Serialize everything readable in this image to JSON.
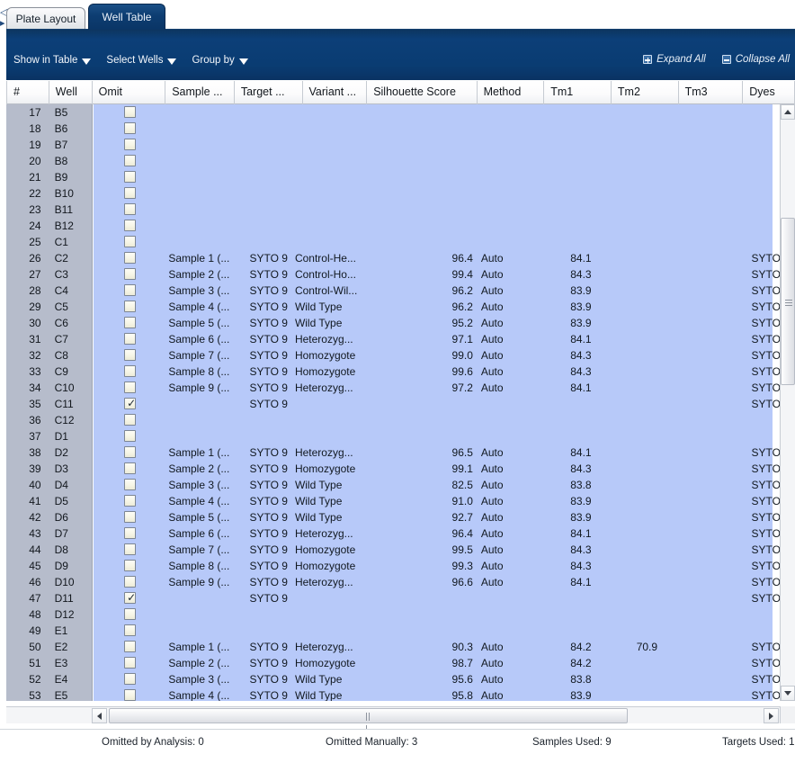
{
  "tabs": [
    {
      "label": "Plate Layout",
      "active": false
    },
    {
      "label": "Well Table",
      "active": true
    }
  ],
  "toolbar": {
    "show_in_table": "Show in Table",
    "select_wells": "Select Wells",
    "group_by": "Group by",
    "expand_all": "Expand All",
    "collapse_all": "Collapse All",
    "expand_icon": "plus-box-icon",
    "collapse_icon": "minus-box-icon",
    "caret_icon": "chevron-down-icon",
    "bg_color": "#0a3c72"
  },
  "table": {
    "columns": [
      {
        "key": "num",
        "label": "#"
      },
      {
        "key": "well",
        "label": "Well"
      },
      {
        "key": "omit",
        "label": "Omit"
      },
      {
        "key": "sample",
        "label": "Sample ..."
      },
      {
        "key": "target",
        "label": "Target ..."
      },
      {
        "key": "variant",
        "label": "Variant ..."
      },
      {
        "key": "silhouette",
        "label": "Silhouette Score"
      },
      {
        "key": "method",
        "label": "Method"
      },
      {
        "key": "tm1",
        "label": "Tm1"
      },
      {
        "key": "tm2",
        "label": "Tm2"
      },
      {
        "key": "tm3",
        "label": "Tm3"
      },
      {
        "key": "dyes",
        "label": "Dyes"
      }
    ],
    "selection_color": "#b7c9f9",
    "rowheader_color": "#b6bccb",
    "rows": [
      {
        "num": "17",
        "well": "B5",
        "omit": false,
        "sample": "",
        "dye": "",
        "variant": "",
        "sil": "",
        "method": "",
        "tm1": "",
        "tm2": "",
        "tm3": "",
        "dyes": ""
      },
      {
        "num": "18",
        "well": "B6",
        "omit": false,
        "sample": "",
        "dye": "",
        "variant": "",
        "sil": "",
        "method": "",
        "tm1": "",
        "tm2": "",
        "tm3": "",
        "dyes": ""
      },
      {
        "num": "19",
        "well": "B7",
        "omit": false,
        "sample": "",
        "dye": "",
        "variant": "",
        "sil": "",
        "method": "",
        "tm1": "",
        "tm2": "",
        "tm3": "",
        "dyes": ""
      },
      {
        "num": "20",
        "well": "B8",
        "omit": false,
        "sample": "",
        "dye": "",
        "variant": "",
        "sil": "",
        "method": "",
        "tm1": "",
        "tm2": "",
        "tm3": "",
        "dyes": ""
      },
      {
        "num": "21",
        "well": "B9",
        "omit": false,
        "sample": "",
        "dye": "",
        "variant": "",
        "sil": "",
        "method": "",
        "tm1": "",
        "tm2": "",
        "tm3": "",
        "dyes": ""
      },
      {
        "num": "22",
        "well": "B10",
        "omit": false,
        "sample": "",
        "dye": "",
        "variant": "",
        "sil": "",
        "method": "",
        "tm1": "",
        "tm2": "",
        "tm3": "",
        "dyes": ""
      },
      {
        "num": "23",
        "well": "B11",
        "omit": false,
        "sample": "",
        "dye": "",
        "variant": "",
        "sil": "",
        "method": "",
        "tm1": "",
        "tm2": "",
        "tm3": "",
        "dyes": ""
      },
      {
        "num": "24",
        "well": "B12",
        "omit": false,
        "sample": "",
        "dye": "",
        "variant": "",
        "sil": "",
        "method": "",
        "tm1": "",
        "tm2": "",
        "tm3": "",
        "dyes": ""
      },
      {
        "num": "25",
        "well": "C1",
        "omit": false,
        "sample": "",
        "dye": "",
        "variant": "",
        "sil": "",
        "method": "",
        "tm1": "",
        "tm2": "",
        "tm3": "",
        "dyes": ""
      },
      {
        "num": "26",
        "well": "C2",
        "omit": false,
        "sample": "Sample 1 (...",
        "dye": "SYTO 9",
        "variant": "Control-He...",
        "sil": "96.4",
        "method": "Auto",
        "tm1": "84.1",
        "tm2": "",
        "tm3": "",
        "dyes": "SYTO"
      },
      {
        "num": "27",
        "well": "C3",
        "omit": false,
        "sample": "Sample 2 (...",
        "dye": "SYTO 9",
        "variant": "Control-Ho...",
        "sil": "99.4",
        "method": "Auto",
        "tm1": "84.3",
        "tm2": "",
        "tm3": "",
        "dyes": "SYTO"
      },
      {
        "num": "28",
        "well": "C4",
        "omit": false,
        "sample": "Sample 3 (...",
        "dye": "SYTO 9",
        "variant": "Control-Wil...",
        "sil": "96.2",
        "method": "Auto",
        "tm1": "83.9",
        "tm2": "",
        "tm3": "",
        "dyes": "SYTO"
      },
      {
        "num": "29",
        "well": "C5",
        "omit": false,
        "sample": "Sample 4 (...",
        "dye": "SYTO 9",
        "variant": "Wild Type",
        "sil": "96.2",
        "method": "Auto",
        "tm1": "83.9",
        "tm2": "",
        "tm3": "",
        "dyes": "SYTO"
      },
      {
        "num": "30",
        "well": "C6",
        "omit": false,
        "sample": "Sample 5 (...",
        "dye": "SYTO 9",
        "variant": "Wild Type",
        "sil": "95.2",
        "method": "Auto",
        "tm1": "83.9",
        "tm2": "",
        "tm3": "",
        "dyes": "SYTO"
      },
      {
        "num": "31",
        "well": "C7",
        "omit": false,
        "sample": "Sample 6 (...",
        "dye": "SYTO 9",
        "variant": "Heterozyg...",
        "sil": "97.1",
        "method": "Auto",
        "tm1": "84.1",
        "tm2": "",
        "tm3": "",
        "dyes": "SYTO"
      },
      {
        "num": "32",
        "well": "C8",
        "omit": false,
        "sample": "Sample 7 (...",
        "dye": "SYTO 9",
        "variant": "Homozygote",
        "sil": "99.0",
        "method": "Auto",
        "tm1": "84.3",
        "tm2": "",
        "tm3": "",
        "dyes": "SYTO"
      },
      {
        "num": "33",
        "well": "C9",
        "omit": false,
        "sample": "Sample 8 (...",
        "dye": "SYTO 9",
        "variant": "Homozygote",
        "sil": "99.6",
        "method": "Auto",
        "tm1": "84.3",
        "tm2": "",
        "tm3": "",
        "dyes": "SYTO"
      },
      {
        "num": "34",
        "well": "C10",
        "omit": false,
        "sample": "Sample 9 (...",
        "dye": "SYTO 9",
        "variant": "Heterozyg...",
        "sil": "97.2",
        "method": "Auto",
        "tm1": "84.1",
        "tm2": "",
        "tm3": "",
        "dyes": "SYTO"
      },
      {
        "num": "35",
        "well": "C11",
        "omit": true,
        "sample": "",
        "dye": "SYTO 9",
        "variant": "",
        "sil": "",
        "method": "",
        "tm1": "",
        "tm2": "",
        "tm3": "",
        "dyes": "SYTO"
      },
      {
        "num": "36",
        "well": "C12",
        "omit": false,
        "sample": "",
        "dye": "",
        "variant": "",
        "sil": "",
        "method": "",
        "tm1": "",
        "tm2": "",
        "tm3": "",
        "dyes": ""
      },
      {
        "num": "37",
        "well": "D1",
        "omit": false,
        "sample": "",
        "dye": "",
        "variant": "",
        "sil": "",
        "method": "",
        "tm1": "",
        "tm2": "",
        "tm3": "",
        "dyes": ""
      },
      {
        "num": "38",
        "well": "D2",
        "omit": false,
        "sample": "Sample 1 (...",
        "dye": "SYTO 9",
        "variant": "Heterozyg...",
        "sil": "96.5",
        "method": "Auto",
        "tm1": "84.1",
        "tm2": "",
        "tm3": "",
        "dyes": "SYTO"
      },
      {
        "num": "39",
        "well": "D3",
        "omit": false,
        "sample": "Sample 2 (...",
        "dye": "SYTO 9",
        "variant": "Homozygote",
        "sil": "99.1",
        "method": "Auto",
        "tm1": "84.3",
        "tm2": "",
        "tm3": "",
        "dyes": "SYTO"
      },
      {
        "num": "40",
        "well": "D4",
        "omit": false,
        "sample": "Sample 3 (...",
        "dye": "SYTO 9",
        "variant": "Wild Type",
        "sil": "82.5",
        "method": "Auto",
        "tm1": "83.8",
        "tm2": "",
        "tm3": "",
        "dyes": "SYTO"
      },
      {
        "num": "41",
        "well": "D5",
        "omit": false,
        "sample": "Sample 4 (...",
        "dye": "SYTO 9",
        "variant": "Wild Type",
        "sil": "91.0",
        "method": "Auto",
        "tm1": "83.9",
        "tm2": "",
        "tm3": "",
        "dyes": "SYTO"
      },
      {
        "num": "42",
        "well": "D6",
        "omit": false,
        "sample": "Sample 5 (...",
        "dye": "SYTO 9",
        "variant": "Wild Type",
        "sil": "92.7",
        "method": "Auto",
        "tm1": "83.9",
        "tm2": "",
        "tm3": "",
        "dyes": "SYTO"
      },
      {
        "num": "43",
        "well": "D7",
        "omit": false,
        "sample": "Sample 6 (...",
        "dye": "SYTO 9",
        "variant": "Heterozyg...",
        "sil": "96.4",
        "method": "Auto",
        "tm1": "84.1",
        "tm2": "",
        "tm3": "",
        "dyes": "SYTO"
      },
      {
        "num": "44",
        "well": "D8",
        "omit": false,
        "sample": "Sample 7 (...",
        "dye": "SYTO 9",
        "variant": "Homozygote",
        "sil": "99.5",
        "method": "Auto",
        "tm1": "84.3",
        "tm2": "",
        "tm3": "",
        "dyes": "SYTO"
      },
      {
        "num": "45",
        "well": "D9",
        "omit": false,
        "sample": "Sample 8 (...",
        "dye": "SYTO 9",
        "variant": "Homozygote",
        "sil": "99.3",
        "method": "Auto",
        "tm1": "84.3",
        "tm2": "",
        "tm3": "",
        "dyes": "SYTO"
      },
      {
        "num": "46",
        "well": "D10",
        "omit": false,
        "sample": "Sample 9 (...",
        "dye": "SYTO 9",
        "variant": "Heterozyg...",
        "sil": "96.6",
        "method": "Auto",
        "tm1": "84.1",
        "tm2": "",
        "tm3": "",
        "dyes": "SYTO"
      },
      {
        "num": "47",
        "well": "D11",
        "omit": true,
        "sample": "",
        "dye": "SYTO 9",
        "variant": "",
        "sil": "",
        "method": "",
        "tm1": "",
        "tm2": "",
        "tm3": "",
        "dyes": "SYTO"
      },
      {
        "num": "48",
        "well": "D12",
        "omit": false,
        "sample": "",
        "dye": "",
        "variant": "",
        "sil": "",
        "method": "",
        "tm1": "",
        "tm2": "",
        "tm3": "",
        "dyes": ""
      },
      {
        "num": "49",
        "well": "E1",
        "omit": false,
        "sample": "",
        "dye": "",
        "variant": "",
        "sil": "",
        "method": "",
        "tm1": "",
        "tm2": "",
        "tm3": "",
        "dyes": ""
      },
      {
        "num": "50",
        "well": "E2",
        "omit": false,
        "sample": "Sample 1 (...",
        "dye": "SYTO 9",
        "variant": "Heterozyg...",
        "sil": "90.3",
        "method": "Auto",
        "tm1": "84.2",
        "tm2": "70.9",
        "tm3": "",
        "dyes": "SYTO"
      },
      {
        "num": "51",
        "well": "E3",
        "omit": false,
        "sample": "Sample 2 (...",
        "dye": "SYTO 9",
        "variant": "Homozygote",
        "sil": "98.7",
        "method": "Auto",
        "tm1": "84.2",
        "tm2": "",
        "tm3": "",
        "dyes": "SYTO"
      },
      {
        "num": "52",
        "well": "E4",
        "omit": false,
        "sample": "Sample 3 (...",
        "dye": "SYTO 9",
        "variant": "Wild Type",
        "sil": "95.6",
        "method": "Auto",
        "tm1": "83.8",
        "tm2": "",
        "tm3": "",
        "dyes": "SYTO"
      },
      {
        "num": "53",
        "well": "E5",
        "omit": false,
        "sample": "Sample 4 (...",
        "dye": "SYTO 9",
        "variant": "Wild Type",
        "sil": "95.8",
        "method": "Auto",
        "tm1": "83.9",
        "tm2": "",
        "tm3": "",
        "dyes": "SYTO"
      }
    ]
  },
  "scrollbars": {
    "vertical": {
      "up_icon": "triangle-up-icon",
      "down_icon": "triangle-down-icon"
    },
    "horizontal": {
      "left_icon": "triangle-left-icon",
      "right_icon": "triangle-right-icon"
    }
  },
  "status": {
    "omitted_by_analysis_label": "Omitted by Analysis:",
    "omitted_by_analysis_value": "0",
    "omitted_manually_label": "Omitted Manually:",
    "omitted_manually_value": "3",
    "samples_used_label": "Samples Used:",
    "samples_used_value": "9",
    "targets_used_label": "Targets Used:",
    "targets_used_value": "1"
  }
}
